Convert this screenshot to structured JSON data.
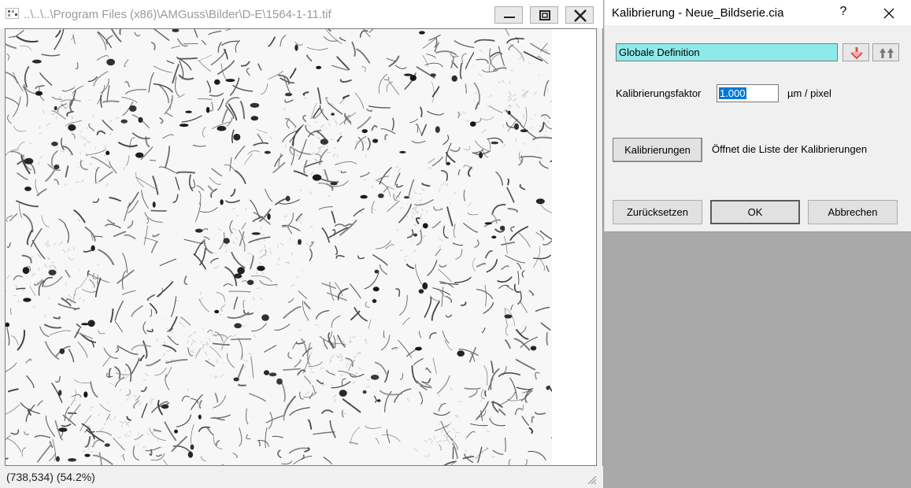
{
  "image_window": {
    "title": "..\\..\\..\\Program Files (x86)\\AMGuss\\Bilder\\D-E\\1564-1-11.tif",
    "status": "(738,534) (54.2%)"
  },
  "dialog": {
    "title": "Kalibrierung - Neue_Bildserie.cia",
    "help": "?",
    "definition_value": "Globale Definition",
    "factor_label": "Kalibrierungsfaktor",
    "factor_value": "1.000",
    "factor_unit": "µm / pixel",
    "calibrations_button": "Kalibrierungen",
    "calibrations_hint": "Öffnet die Liste der Kalibrierungen",
    "reset_button": "Zurücksetzen",
    "ok_button": "OK",
    "cancel_button": "Abbrechen"
  },
  "icons": {
    "minimize": "minimize-icon",
    "maximize": "maximize-icon",
    "close": "close-icon",
    "arrow_down": "red-arrow-down-icon",
    "arrows_up": "double-arrow-up-icon",
    "resize_grip": "resize-grip-icon"
  }
}
